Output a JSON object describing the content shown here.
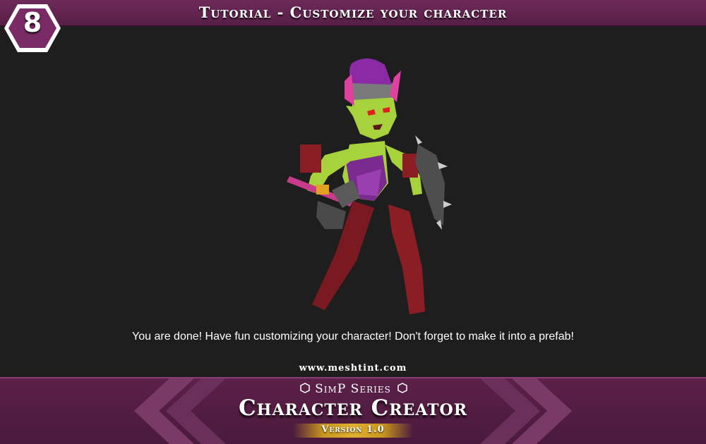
{
  "header": {
    "step_number": "8",
    "title": "Tutorial - Customize your character"
  },
  "main": {
    "caption": "You are done! Have fun customizing your character! Don't forget to make it into a prefab!"
  },
  "footer": {
    "website": "www.meshtint.com",
    "series": "SimP Series",
    "product": "Character Creator",
    "version": "Version 1.0"
  },
  "icons": [
    "hexagon-badge",
    "hexagon-bullet-icon",
    "chevron-left-icon",
    "chevron-right-icon"
  ],
  "colors": {
    "accent_purple": "#6e2a5a",
    "background": "#1e1e1e",
    "version_gold": "#e0b030",
    "text": "#ffffff"
  }
}
